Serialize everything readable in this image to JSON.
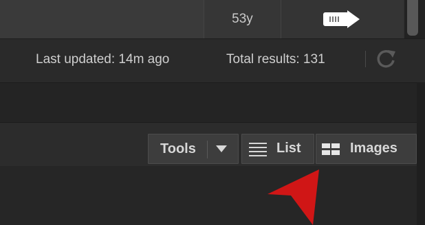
{
  "results_table": {
    "row": {
      "age": "53y",
      "action_icon": "arrow-right-icon"
    }
  },
  "status": {
    "last_updated": "Last updated: 14m ago",
    "total_results": "Total results: 131",
    "refresh_icon": "refresh-icon"
  },
  "toolbar": {
    "tools_label": "Tools",
    "tools_caret_icon": "caret-down-icon",
    "list_label": "List",
    "list_icon": "list-icon",
    "images_label": "Images",
    "images_icon": "grid-icon"
  },
  "annotation": {
    "color": "#d01616",
    "icon": "red-pointer-arrow"
  }
}
